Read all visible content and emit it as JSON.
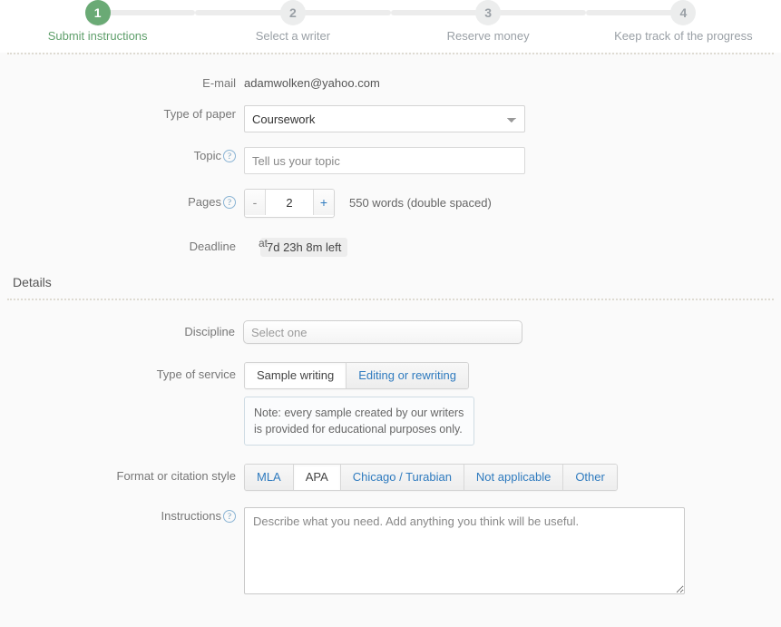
{
  "stepper": {
    "steps": [
      {
        "number": "1",
        "label": "Submit instructions",
        "state": "active"
      },
      {
        "number": "2",
        "label": "Select a writer",
        "state": "inactive"
      },
      {
        "number": "3",
        "label": "Reserve money",
        "state": "inactive"
      },
      {
        "number": "4",
        "label": "Keep track of the progress",
        "state": "inactive"
      }
    ],
    "active_color": "#6aaa75",
    "inactive_color": "#9aa0a6"
  },
  "form": {
    "email": {
      "label": "E-mail",
      "value": "adamwolken@yahoo.com"
    },
    "type_of_paper": {
      "label": "Type of paper",
      "value": "Coursework",
      "options": [
        "Coursework"
      ]
    },
    "topic": {
      "label": "Topic",
      "help": "?",
      "placeholder": "Tell us your topic",
      "value": ""
    },
    "pages": {
      "label": "Pages",
      "help": "?",
      "minus_label": "-",
      "plus_label": "+",
      "value": "2",
      "words_note": "550 words (double spaced)"
    },
    "deadline": {
      "label": "Deadline",
      "at_label": "at",
      "badge": "7d 23h 8m left"
    }
  },
  "details": {
    "section_title": "Details",
    "discipline": {
      "label": "Discipline",
      "placeholder": "Select one",
      "value": ""
    },
    "type_of_service": {
      "label": "Type of service",
      "options": [
        {
          "label": "Sample writing",
          "selected": true
        },
        {
          "label": "Editing or rewriting",
          "selected": false
        }
      ],
      "note": "Note: every sample created by our writers is provided for educational purposes only."
    },
    "citation_style": {
      "label": "Format or citation style",
      "options": [
        {
          "label": "MLA",
          "selected": false
        },
        {
          "label": "APA",
          "selected": true
        },
        {
          "label": "Chicago / Turabian",
          "selected": false
        },
        {
          "label": "Not applicable",
          "selected": false
        },
        {
          "label": "Other",
          "selected": false
        }
      ]
    },
    "instructions": {
      "label": "Instructions",
      "help": "?",
      "placeholder": "Describe what you need. Add anything you think will be useful.",
      "value": ""
    }
  }
}
